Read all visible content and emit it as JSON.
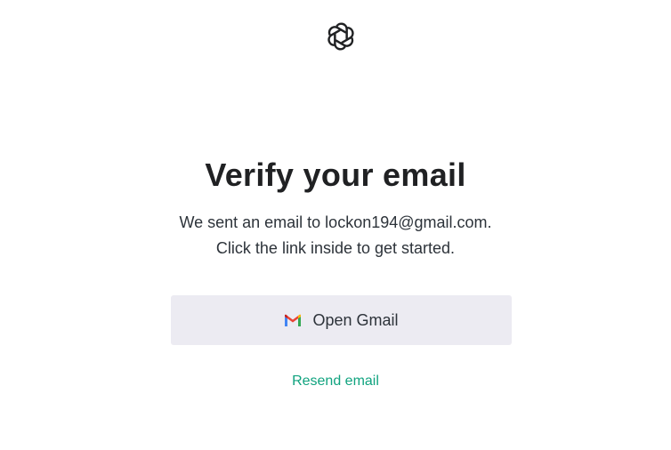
{
  "logo": {
    "icon": "openai-logo-icon"
  },
  "heading": {
    "title": "Verify your email"
  },
  "message": {
    "line1": "We sent an email to lockon194@gmail.com.",
    "line2": "Click the link inside to get started."
  },
  "open_gmail_button": {
    "label": "Open Gmail",
    "icon": "gmail-icon"
  },
  "resend_link": {
    "label": "Resend email"
  },
  "colors": {
    "accent": "#10a37f",
    "button_bg": "#ecebf2",
    "title": "#202123",
    "text": "#2d333a"
  }
}
